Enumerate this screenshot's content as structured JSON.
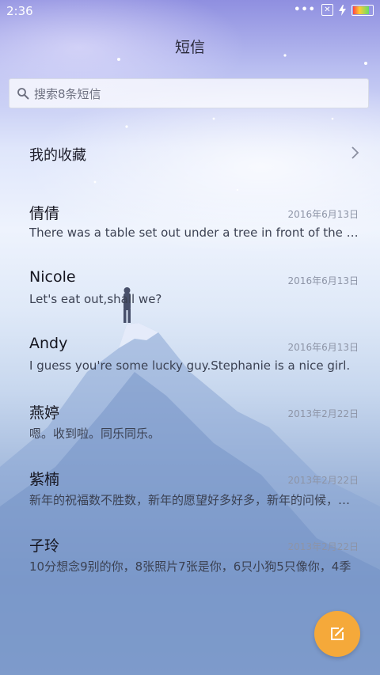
{
  "status_bar": {
    "time": "2:36",
    "dots": "•••",
    "sim_icon": "✕",
    "icons": [
      "more-dots-icon",
      "no-sim-icon",
      "charging-icon",
      "battery-icon"
    ]
  },
  "header": {
    "title": "短信"
  },
  "search": {
    "placeholder": "搜索8条短信"
  },
  "favorites": {
    "label": "我的收藏"
  },
  "conversations": [
    {
      "name": "倩倩",
      "date": "2016年6月13日",
      "preview": "There was a table set out under a tree in front of the house"
    },
    {
      "name": "Nicole",
      "date": "2016年6月13日",
      "preview": "Let's eat out,shall we?"
    },
    {
      "name": "Andy",
      "date": "2016年6月13日",
      "preview": "I guess you're some lucky guy.Stephanie is a nice girl."
    },
    {
      "name": "燕婷",
      "date": "2013年2月22日",
      "preview": "嗯。收到啦。同乐同乐。"
    },
    {
      "name": "紫楠",
      "date": "2013年2月22日",
      "preview": "新年的祝福数不胜数，新年的愿望好多好多，新年的问候，新年的祝愿"
    },
    {
      "name": "子玲",
      "date": "2013年2月22日",
      "preview": "10分想念9别的你，8张照片7张是你，6只小狗5只像你，4季"
    }
  ],
  "fab": {
    "icon": "compose-icon"
  },
  "colors": {
    "accent": "#f5a93a",
    "date_text": "#8d94a6"
  }
}
